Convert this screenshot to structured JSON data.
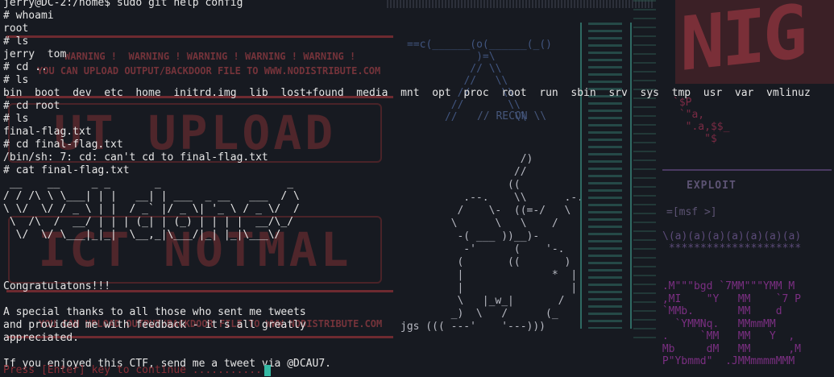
{
  "background": {
    "warning_line_1": "WARNING !  WARNING ! WARNING ! WARNING ! WARNING !",
    "warning_line_2": "YOU CAN UPLOAD OUTPUT/BACKDOOR FILE TO WWW.NODISTRIBUTE.COM",
    "warning_line_3": "YOU CAN UPLOAD OUTPUT/BACKDOOR FILE TO WWW.NODISTRIBUTE.COM",
    "big_text_1": "UT UPLOAD",
    "big_text_2": "ICT NOTMAL",
    "recon_art": "==c(______(o(______(_()\n           )=\\\n          // \\\\\n         //   \\\\\n        //     \\\\\n       //       \\\\\n      //         \\\\",
    "recon_label": "// RECON \\\\",
    "cat_art": "                   /)\n                  //\n                 ((\n          .--.    \\\\      .-.\n         /    \\-  ((=-/   \\\n        \\      \\   \\    /\n         -( ___ ))__)-\n          -'      (    '-.\n         (       ((       )\n         |              *  |\n         |                 |\n         \\   |_w_|       /\n        _)  \\   /      (_\njgs ((( ---'    '---)))",
    "logo_text": "NIG",
    "money_art": "`$P\n `\"a,\n  \".a,$$_\n     \"$",
    "exploit_label": "EXPLOIT",
    "msf_label": "=[msf >]",
    "faces_art": "\\(a)(a)(a)(a)(a)(a)(a)\n *********************",
    "magic_art": " .M\"\"\"bgd `7MM\"\"\"YMM M\n ,MI    \"Y   MM    `7 P\n `MMb.       MM    d\n   `YMMNq.   MMmmMM\n .     `MM   MM   Y  ,\n Mb     dM   MM      ,M\n P\"Ybmmd\"  .JMMmmmmMMM"
  },
  "terminal": {
    "output": "jerry@DC-2:/home$ sudo git help config\n# whoami\nroot\n# ls\njerry  tom\n# cd ..\n# ls\nbin  boot  dev  etc  home  initrd.img  lib  lost+found  media  mnt  opt  proc  root  run  sbin  srv  sys  tmp  usr  var  vmlinuz\n# cd root\n# ls\nfinal-flag.txt\n# cd final-flag.txt\n/bin/sh: 7: cd: can't cd to final-flag.txt\n# cat final-flag.txt\n __    __     _ _       _                    _\n/ / /\\ \\ \\___| | |   __| | ___  _ __   ___  / \\\n\\ \\/  \\/ / _ \\ | |  / _` |/ _ \\| '_ \\ / _ \\/  /\n \\  /\\  /  __/ | | | (_| | (_) | | | |  __/\\_/\n  \\/  \\/ \\___|_|_|  \\__,_|\\___/|_| |_|\\___\\/\n\n\n\nCongratulatons!!!\n\nA special thanks to all those who sent me tweets\nand provided me with feedback - it's all greatly\nappreciated.\n\nIf you enjoyed this CTF, send me a tweet via @DCAU7.",
    "press_enter": "Press [Enter] key to continue ............"
  }
}
